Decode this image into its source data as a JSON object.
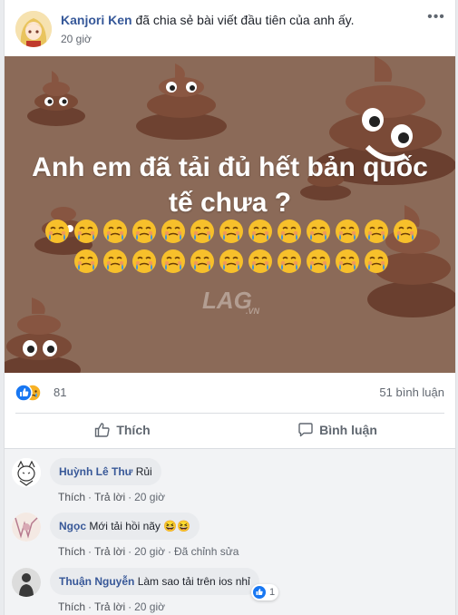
{
  "post": {
    "author": "Kanjori Ken",
    "action": "đã chia sẻ bài viết đầu tiên của anh ấy.",
    "timestamp": "20 giờ",
    "more_icon": "ellipsis-icon",
    "image": {
      "headline_line1": "Anh em đã tải đủ hết bản quốc",
      "headline_line2": "tế chưa ?",
      "watermark": "LAG.VN",
      "background_color": "#8b6a58",
      "emoji_icon": "crying-smile-emoji",
      "emoji_row1_count": 13,
      "emoji_row2_count": 11
    }
  },
  "stats": {
    "reactions": [
      "like",
      "sad"
    ],
    "reaction_count": "81",
    "comment_count": "51 bình luận"
  },
  "actions": {
    "like_label": "Thích",
    "comment_label": "Bình luận"
  },
  "comments": [
    {
      "name": "Huỳnh Lê Thư",
      "text": "Rủi",
      "like": "Thích",
      "reply": "Trả lời",
      "time": "20 giờ"
    },
    {
      "name": "Ngọc",
      "text": "Mới tải hồi nãy 😆😆",
      "like": "Thích",
      "reply": "Trả lời",
      "time": "20 giờ",
      "edited": "Đã chỉnh sửa"
    },
    {
      "name": "Thuận Nguyễn",
      "text": "Làm sao tải trên ios nhỉ",
      "like": "Thích",
      "reply": "Trả lời",
      "time": "20 giờ",
      "reaction_count": "1"
    }
  ],
  "colors": {
    "link_blue": "#365899",
    "like_blue": "#1877f2",
    "poop_brown": "#6b4030"
  }
}
